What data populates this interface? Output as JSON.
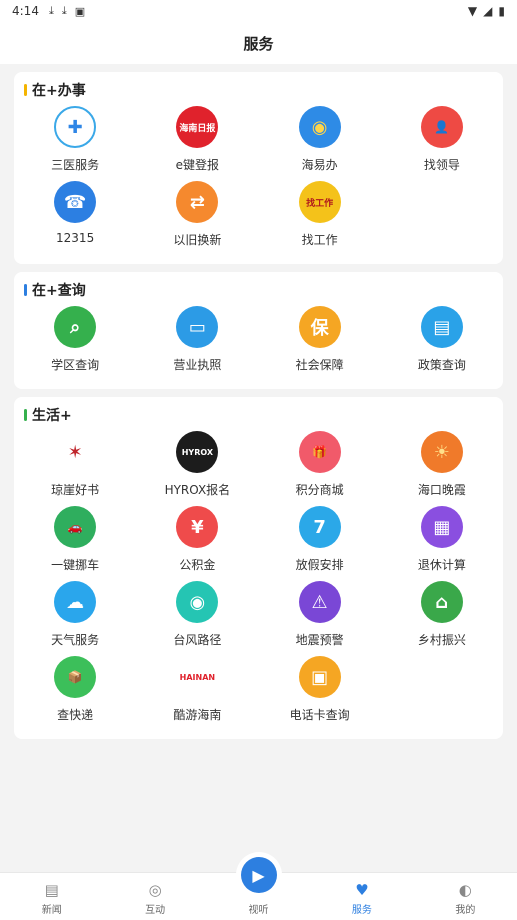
{
  "status": {
    "time": "4:14",
    "icons": [
      "download-icon",
      "download-icon",
      "a-icon"
    ],
    "right_icons": [
      "wifi-icon",
      "signal-icon",
      "battery-icon"
    ]
  },
  "header": {
    "title": "服务"
  },
  "sections": [
    {
      "title": "在+办事",
      "bar_color": "#f4b400",
      "items": [
        {
          "label": "三医服务",
          "icon": "medical-cross-icon",
          "color": "#ffffff",
          "border": "#3aa8e8",
          "glyph": "✚",
          "glyph_color": "#2f86e6"
        },
        {
          "label": "e键登报",
          "icon": "hainan-daily-logo-icon",
          "color": "#e0222c",
          "glyph": "海南日报",
          "glyph_color": "#ffffff"
        },
        {
          "label": "海易办",
          "icon": "haiyiban-icon",
          "color": "#2e8be6",
          "glyph": "◉",
          "glyph_color": "#ffd54a"
        },
        {
          "label": "找领导",
          "icon": "person-icon",
          "color": "#ee4a44",
          "glyph": "👤",
          "glyph_color": "#ffffff"
        },
        {
          "label": "12315",
          "icon": "headset-icon",
          "color": "#2c7fe2",
          "glyph": "☎",
          "glyph_color": "#ffffff"
        },
        {
          "label": "以旧换新",
          "icon": "exchange-icon",
          "color": "#f5892e",
          "glyph": "⇄",
          "glyph_color": "#ffffff"
        },
        {
          "label": "找工作",
          "icon": "job-icon",
          "color": "#f4c21a",
          "glyph": "找工作",
          "glyph_color": "#b0181d"
        }
      ]
    },
    {
      "title": "在+查询",
      "bar_color": "#2d7fe0",
      "items": [
        {
          "label": "学区查询",
          "icon": "building-search-icon",
          "color": "#35b04d",
          "glyph": "⌕",
          "glyph_color": "#ffffff"
        },
        {
          "label": "营业执照",
          "icon": "license-icon",
          "color": "#2c9be6",
          "glyph": "▭",
          "glyph_color": "#ffffff"
        },
        {
          "label": "社会保障",
          "icon": "shield-icon",
          "color": "#f5a623",
          "glyph": "保",
          "glyph_color": "#ffffff"
        },
        {
          "label": "政策查询",
          "icon": "document-icon",
          "color": "#2aa2e8",
          "glyph": "▤",
          "glyph_color": "#ffffff"
        }
      ]
    },
    {
      "title": "生活+",
      "bar_color": "#35b04d",
      "items": [
        {
          "label": "琼崖好书",
          "icon": "book-logo-icon",
          "color": "#ffffff",
          "glyph": "✶",
          "glyph_color": "#c0262c"
        },
        {
          "label": "HYROX报名",
          "icon": "hyrox-logo-icon",
          "color": "#1c1c1c",
          "glyph": "HYROX",
          "glyph_color": "#ffffff"
        },
        {
          "label": "积分商城",
          "icon": "gift-icon",
          "color": "#f15a6a",
          "glyph": "🎁",
          "glyph_color": "#ffffff"
        },
        {
          "label": "海口晚霞",
          "icon": "sunset-icon",
          "color": "#f07a2a",
          "glyph": "☀",
          "glyph_color": "#ffe08a"
        },
        {
          "label": "一键挪车",
          "icon": "car-icon",
          "color": "#2fae5e",
          "glyph": "🚗",
          "glyph_color": "#ffffff"
        },
        {
          "label": "公积金",
          "icon": "house-yen-icon",
          "color": "#ef4b4b",
          "glyph": "¥",
          "glyph_color": "#ffffff"
        },
        {
          "label": "放假安排",
          "icon": "calendar-icon",
          "color": "#2ba8e8",
          "glyph": "7",
          "glyph_color": "#ffffff"
        },
        {
          "label": "退休计算",
          "icon": "calculator-icon",
          "color": "#8a4fe0",
          "glyph": "▦",
          "glyph_color": "#ffffff"
        },
        {
          "label": "天气服务",
          "icon": "weather-cloud-icon",
          "color": "#2aa6ec",
          "glyph": "☁",
          "glyph_color": "#ffffff"
        },
        {
          "label": "台风路径",
          "icon": "typhoon-icon",
          "color": "#25c5b3",
          "glyph": "◉",
          "glyph_color": "#ffffff"
        },
        {
          "label": "地震预警",
          "icon": "earthquake-icon",
          "color": "#7a47d6",
          "glyph": "⚠",
          "glyph_color": "#ffffff"
        },
        {
          "label": "乡村振兴",
          "icon": "village-icon",
          "color": "#3aa84a",
          "glyph": "⌂",
          "glyph_color": "#ffffff"
        },
        {
          "label": "查快递",
          "icon": "package-icon",
          "color": "#3cbf5a",
          "glyph": "📦",
          "glyph_color": "#ffffff"
        },
        {
          "label": "酷游海南",
          "icon": "hainan-travel-logo-icon",
          "color": "#ffffff",
          "glyph": "HAINAN",
          "glyph_color": "#e0222c"
        },
        {
          "label": "电话卡查询",
          "icon": "sim-card-icon",
          "color": "#f5a623",
          "glyph": "▣",
          "glyph_color": "#ffffff"
        }
      ]
    }
  ],
  "tabbar": [
    {
      "label": "新闻",
      "icon": "news-icon",
      "glyph": "▤",
      "active": false
    },
    {
      "label": "互动",
      "icon": "compass-icon",
      "glyph": "◎",
      "active": false
    },
    {
      "label": "视听",
      "icon": "play-icon",
      "glyph": "▶",
      "active": false,
      "center": true
    },
    {
      "label": "服务",
      "icon": "heart-icon",
      "glyph": "♥",
      "active": true
    },
    {
      "label": "我的",
      "icon": "profile-icon",
      "glyph": "◐",
      "active": false
    }
  ]
}
